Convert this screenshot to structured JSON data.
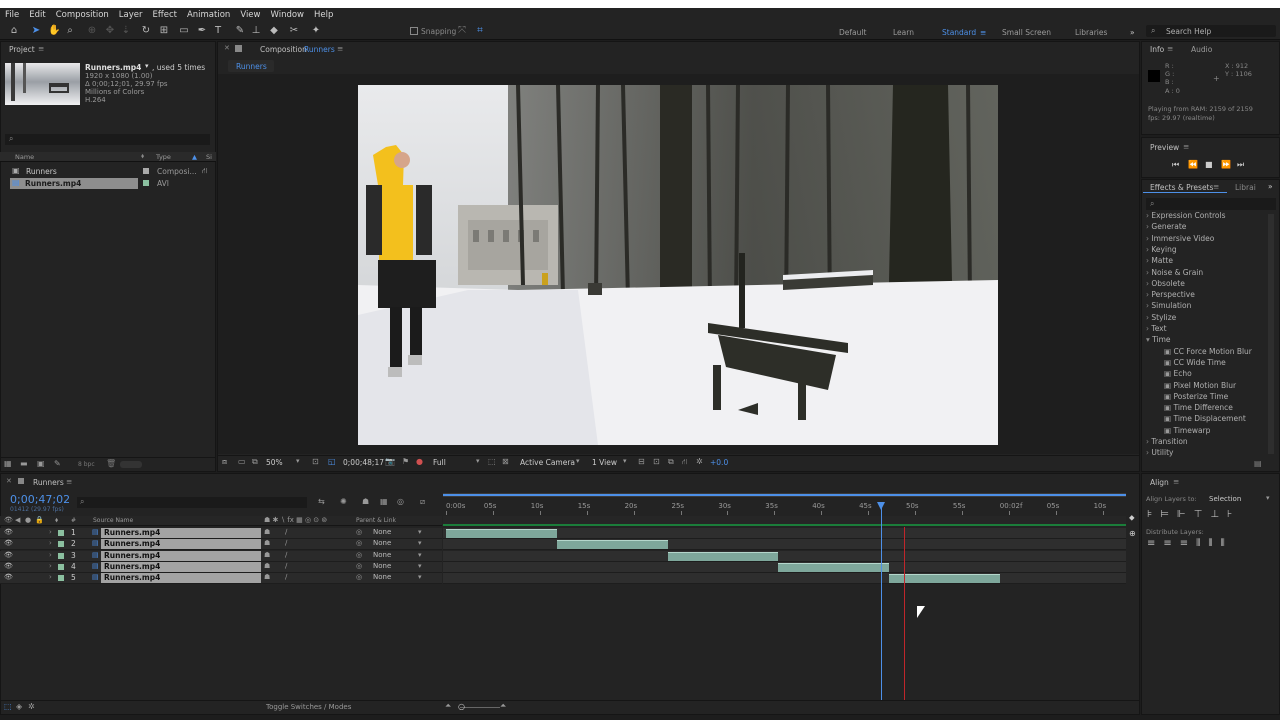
{
  "menu": [
    "File",
    "Edit",
    "Composition",
    "Layer",
    "Effect",
    "Animation",
    "View",
    "Window",
    "Help"
  ],
  "toolbar": {
    "snapping": "Snapping"
  },
  "workspaces": [
    "Default",
    "Learn",
    "Standard",
    "Small Screen",
    "Libraries"
  ],
  "search_help": "Search Help",
  "project": {
    "tab": "Project",
    "thumb_name": "Runners.mp4",
    "used": ", used 5 times",
    "meta": [
      "1920 x 1080 (1.00)",
      "Δ 0;00;12;01, 29.97 fps",
      "Millions of Colors",
      "H.264"
    ],
    "col_name": "Name",
    "col_type": "Type",
    "col_s": "Si",
    "items": [
      {
        "name": "Runners",
        "type": "Composi..."
      },
      {
        "name": "Runners.mp4",
        "type": "AVI"
      }
    ],
    "bpc": "8 bpc"
  },
  "composition": {
    "tab": "Composition",
    "name": "Runners",
    "breadcrumb": "Runners",
    "zoom": "50%",
    "timecode": "0;00;48;17",
    "quality": "Full",
    "camera": "Active Camera",
    "views": "1 View",
    "exposure": "+0.0"
  },
  "info": {
    "tab": "Info",
    "audio": "Audio",
    "rgba": [
      "R :",
      "G :",
      "B :",
      "A : 0"
    ],
    "x": "X : 912",
    "y": "Y : 1106",
    "playing": "Playing from RAM: 2159 of 2159",
    "fps": "fps: 29.97 (realtime)"
  },
  "preview": {
    "tab": "Preview"
  },
  "effects": {
    "tab": "Effects & Presets",
    "lib": "Librai",
    "categories": [
      "Expression Controls",
      "Generate",
      "Immersive Video",
      "Keying",
      "Matte",
      "Noise & Grain",
      "Obsolete",
      "Perspective",
      "Simulation",
      "Stylize",
      "Text",
      "Time"
    ],
    "time_items": [
      "CC Force Motion Blur",
      "CC Wide Time",
      "Echo",
      "Pixel Motion Blur",
      "Posterize Time",
      "Time Difference",
      "Time Displacement",
      "Timewarp"
    ],
    "after": [
      "Transition",
      "Utility"
    ]
  },
  "align": {
    "tab": "Align",
    "align_to_label": "Align Layers to:",
    "align_to": "Selection",
    "distribute": "Distribute Layers:"
  },
  "timeline": {
    "tab": "Runners",
    "time": "0;00;47;02",
    "frames": "01412 (29.97 fps)",
    "col_source": "Source Name",
    "col_parent": "Parent & Link",
    "col_hash": "#",
    "layers": [
      {
        "num": "1",
        "name": "Runners.mp4",
        "parent": "None",
        "start": 0,
        "end": 12
      },
      {
        "num": "2",
        "name": "Runners.mp4",
        "parent": "None",
        "start": 12,
        "end": 24
      },
      {
        "num": "3",
        "name": "Runners.mp4",
        "parent": "None",
        "start": 24,
        "end": 36
      },
      {
        "num": "4",
        "name": "Runners.mp4",
        "parent": "None",
        "start": 36,
        "end": 48
      },
      {
        "num": "5",
        "name": "Runners.mp4",
        "parent": "None",
        "start": 48,
        "end": 60
      }
    ],
    "ticks": [
      "0:00s",
      "05s",
      "10s",
      "15s",
      "20s",
      "25s",
      "30s",
      "35s",
      "40s",
      "45s",
      "50s",
      "55s",
      "00:02f",
      "05s",
      "10s"
    ],
    "playhead_sec": 47.07,
    "toggle": "Toggle Switches / Modes"
  }
}
